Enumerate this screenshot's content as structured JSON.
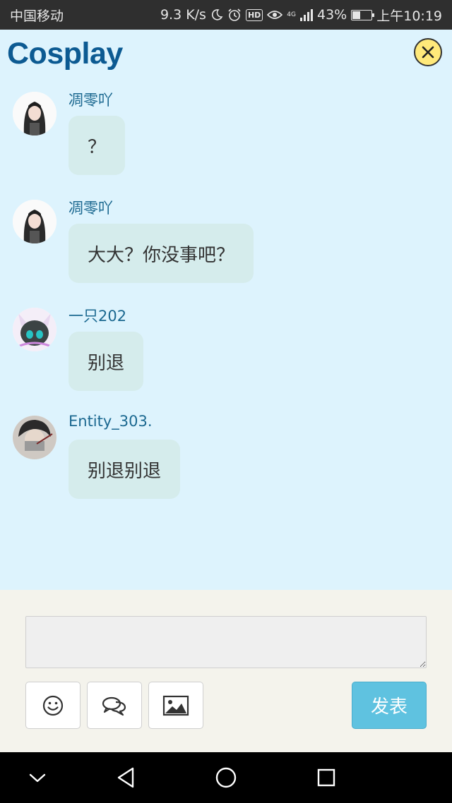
{
  "status_bar": {
    "carrier": "中国移动",
    "speed": "9.3 K/s",
    "hd": "HD",
    "network": "4G",
    "battery": "43%",
    "battery_level": 0.43,
    "time": "上午10:19"
  },
  "header": {
    "title": "Cosplay",
    "close_icon": "close-icon"
  },
  "messages": [
    {
      "user": "凋零吖",
      "text": "？",
      "avatar": "avatar-girl-dark-hair"
    },
    {
      "user": "凋零吖",
      "text": "大大？你没事吧？",
      "avatar": "avatar-girl-dark-hair"
    },
    {
      "user": "一只202",
      "text": "别退",
      "avatar": "avatar-cat-ears"
    },
    {
      "user": "Entity_303.",
      "text": "别退别退",
      "avatar": "avatar-masked-boy"
    }
  ],
  "composer": {
    "input_value": "",
    "emoji_icon": "emoji-icon",
    "chat_icon": "chat-bubbles-icon",
    "image_icon": "image-icon",
    "send_label": "发表"
  },
  "nav_bar": {
    "icons": [
      "chevron-down-icon",
      "back-triangle-icon",
      "home-circle-icon",
      "recents-square-icon"
    ]
  },
  "colors": {
    "background": "#ddf3fd",
    "title": "#0c5a92",
    "username": "#1b6890",
    "bubble": "#d5ecec",
    "send_button": "#5fc2e0",
    "close_button": "#ffe97a"
  }
}
